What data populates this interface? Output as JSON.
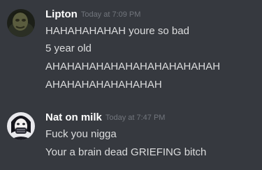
{
  "messages": [
    {
      "username": "Lipton",
      "timestamp": "Today at 7:09 PM",
      "lines": [
        "HAHAHAHAHAH youre so bad",
        "5 year old",
        "AHAHAHAHAHAHAHAHAHAHAHAH",
        "AHAHAHAHAHAHAHAH"
      ]
    },
    {
      "username": "Nat on milk",
      "timestamp": "Today at 7:47 PM",
      "lines": [
        "Fuck you nigga",
        "Your a brain dead GRIEFING bitch"
      ]
    }
  ],
  "colors": {
    "background": "#36393f",
    "username": "#ffffff",
    "timestamp": "#72767d",
    "message_text": "#dcddde"
  }
}
